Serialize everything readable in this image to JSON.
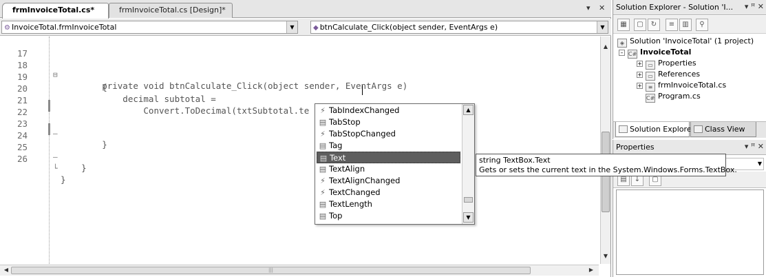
{
  "editor": {
    "tabs": [
      {
        "label": "frmInvoiceTotal.cs*",
        "active": true
      },
      {
        "label": "frmInvoiceTotal.cs [Design]*",
        "active": false
      }
    ],
    "tab_controls": {
      "dropdown": "▾",
      "close": "✕"
    },
    "nav": {
      "class_combo": "InvoiceTotal.frmInvoiceTotal",
      "member_combo": "btnCalculate_Click(object sender, EventArgs e)"
    },
    "lines": [
      {
        "num": "17",
        "text": ""
      },
      {
        "num": "18",
        "text": "        private void btnCalculate_Click(object sender, EventArgs e)"
      },
      {
        "num": "19",
        "text": "        {"
      },
      {
        "num": "20",
        "text": "            decimal subtotal ="
      },
      {
        "num": "21",
        "text": "                Convert.ToDecimal(txtSubtotal.te"
      },
      {
        "num": "22",
        "text": ""
      },
      {
        "num": "23",
        "text": "        }"
      },
      {
        "num": "24",
        "text": ""
      },
      {
        "num": "25",
        "text": "    }"
      },
      {
        "num": "26",
        "text": "}"
      }
    ]
  },
  "intellisense": {
    "items": [
      {
        "label": "TabIndexChanged",
        "kind": "event",
        "icon": "lightning-icon"
      },
      {
        "label": "TabStop",
        "kind": "property",
        "icon": "property-icon"
      },
      {
        "label": "TabStopChanged",
        "kind": "event",
        "icon": "lightning-icon"
      },
      {
        "label": "Tag",
        "kind": "property",
        "icon": "property-icon"
      },
      {
        "label": "Text",
        "kind": "property",
        "icon": "property-icon",
        "selected": true
      },
      {
        "label": "TextAlign",
        "kind": "property",
        "icon": "property-icon"
      },
      {
        "label": "TextAlignChanged",
        "kind": "event",
        "icon": "lightning-icon"
      },
      {
        "label": "TextChanged",
        "kind": "event",
        "icon": "lightning-icon"
      },
      {
        "label": "TextLength",
        "kind": "property",
        "icon": "property-icon"
      },
      {
        "label": "Top",
        "kind": "property",
        "icon": "property-icon"
      }
    ],
    "tooltip": {
      "line1": "string TextBox.Text",
      "line2": "Gets or sets the current text in the System.Windows.Forms.TextBox."
    }
  },
  "solution_explorer": {
    "title": "Solution Explorer - Solution 'I...",
    "title_controls": "▾ ꟸ ✕",
    "solution_label": "Solution 'InvoiceTotal' (1 project)",
    "project_label": "InvoiceTotal",
    "nodes": [
      "Properties",
      "References",
      "frmInvoiceTotal.cs",
      "Program.cs"
    ],
    "tabs": [
      "Solution Explorer",
      "Class View"
    ]
  },
  "properties": {
    "title": "Properties",
    "title_controls": "▾ ꟸ ✕"
  },
  "colors": {
    "selection": "#5e5e5e",
    "tab_bg": "#e6e6e6"
  }
}
